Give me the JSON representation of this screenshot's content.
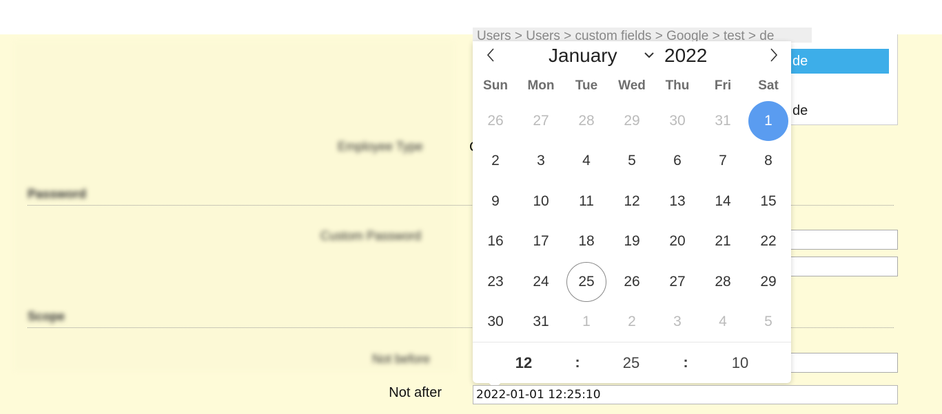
{
  "form": {
    "employee_type_label": "Employee Type",
    "password_section": "Password",
    "custom_password_label": "Custom Password",
    "scope_section": "Scope",
    "not_before_label": "Not before",
    "not_after_label": "Not after",
    "not_after_value": "2022-01-01 12:25:10"
  },
  "breadcrumb": "Users > Users > custom fields > Google > test > de",
  "right_list": {
    "items": [
      {
        "label": "de"
      },
      {
        "label": "de"
      },
      {
        "label": "de"
      }
    ]
  },
  "calendar": {
    "month": "January",
    "year": "2022",
    "weekdays": [
      "Sun",
      "Mon",
      "Tue",
      "Wed",
      "Thu",
      "Fri",
      "Sat"
    ],
    "weeks": [
      [
        "26",
        "27",
        "28",
        "29",
        "30",
        "31",
        "1"
      ],
      [
        "2",
        "3",
        "4",
        "5",
        "6",
        "7",
        "8"
      ],
      [
        "9",
        "10",
        "11",
        "12",
        "13",
        "14",
        "15"
      ],
      [
        "16",
        "17",
        "18",
        "19",
        "20",
        "21",
        "22"
      ],
      [
        "23",
        "24",
        "25",
        "26",
        "27",
        "28",
        "29"
      ],
      [
        "30",
        "31",
        "1",
        "2",
        "3",
        "4",
        "5"
      ]
    ],
    "selected_day": "1",
    "today_day": "25",
    "time": {
      "hour": "12",
      "minute": "25",
      "second": "10",
      "separator": ":"
    }
  },
  "colors": {
    "page_background": "#fefbd8",
    "selected_day": "#5a9cf0",
    "list_selection": "#3daee9"
  }
}
